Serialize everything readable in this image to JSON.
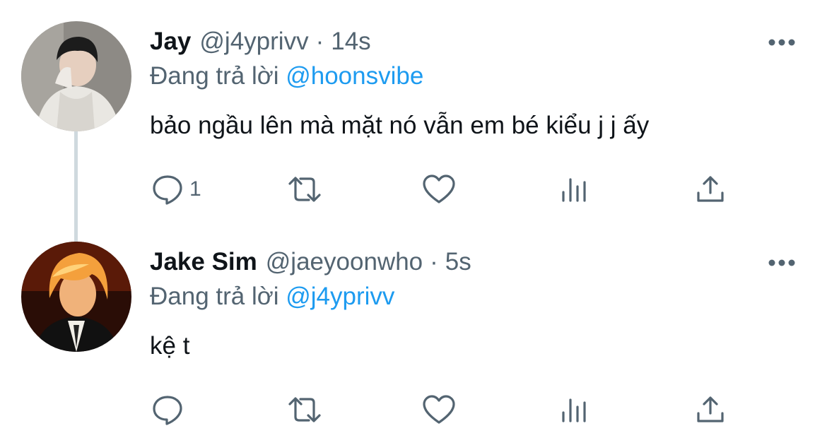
{
  "tweets": [
    {
      "name": "Jay",
      "handle": "@j4yprivv",
      "separator": "·",
      "time": "14s",
      "reply_prefix": "Đang trả lời",
      "reply_mention": "@hoonsvibe",
      "text": "bảo ngầu lên mà mặt nó vẫn em bé kiểu j j ấy",
      "actions": {
        "reply_count": "1",
        "retweet_count": "",
        "like_count": "",
        "views_count": ""
      }
    },
    {
      "name": "Jake Sim",
      "handle": "@jaeyoonwho",
      "separator": "·",
      "time": "5s",
      "reply_prefix": "Đang trả lời",
      "reply_mention": "@j4yprivv",
      "text": "kệ t",
      "actions": {
        "reply_count": "",
        "retweet_count": "",
        "like_count": "",
        "views_count": ""
      }
    }
  ],
  "icons": [
    "reply-icon",
    "retweet-icon",
    "like-icon",
    "views-icon",
    "share-icon",
    "more-icon"
  ],
  "colors": {
    "text": "#0f1419",
    "secondary": "#536471",
    "mention": "#1d9bf0",
    "thread_line": "#cfd9de"
  }
}
